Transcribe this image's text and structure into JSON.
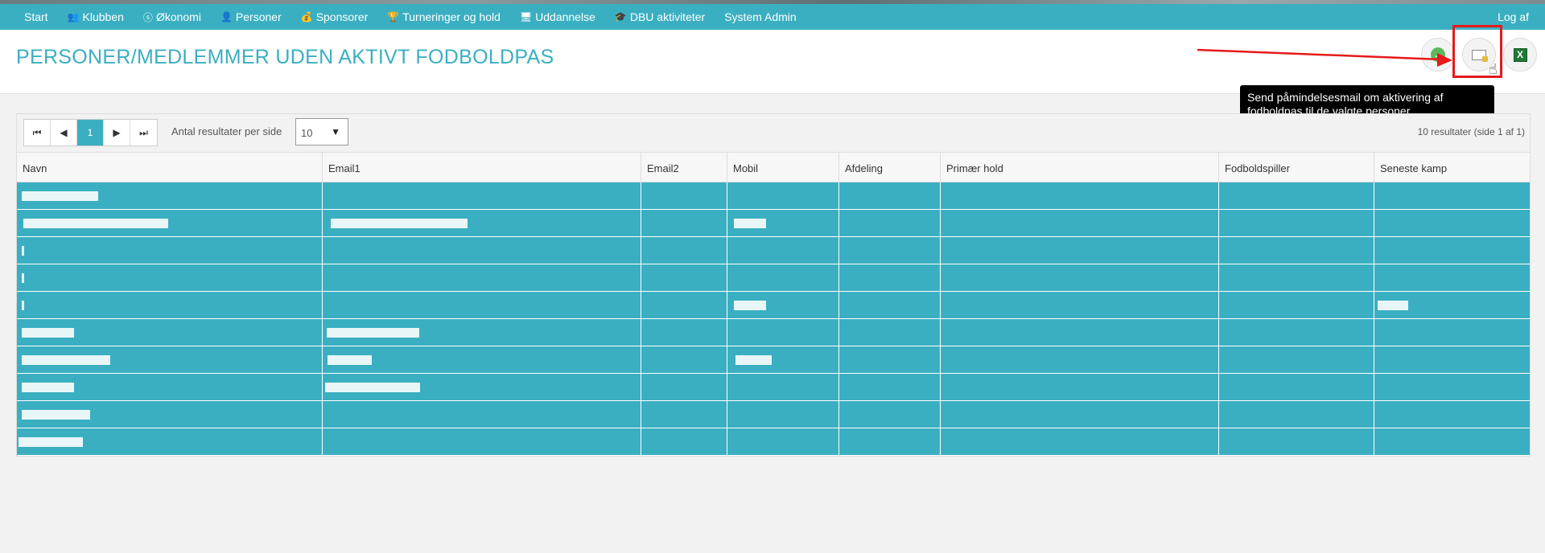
{
  "nav": {
    "items": [
      {
        "label": "Start",
        "icon": ""
      },
      {
        "label": "Klubben",
        "icon": "people-icon"
      },
      {
        "label": "Økonomi",
        "icon": "coin-icon"
      },
      {
        "label": "Personer",
        "icon": "person-icon"
      },
      {
        "label": "Sponsorer",
        "icon": "moneybag-icon"
      },
      {
        "label": "Turneringer og hold",
        "icon": "trophy-icon"
      },
      {
        "label": "Uddannelse",
        "icon": "monitor-icon"
      },
      {
        "label": "DBU aktiviteter",
        "icon": "graduation-cap-icon"
      },
      {
        "label": "System Admin",
        "icon": ""
      }
    ],
    "logout": "Log af"
  },
  "header": {
    "title": "PERSONER/MEDLEMMER UDEN AKTIVT FODBOLDPAS"
  },
  "tooltip": {
    "text": "Send påmindelsesmail om aktivering af fodboldpas til de valgte personer"
  },
  "pager": {
    "current_page": "1",
    "per_page_label": "Antal resultater per side",
    "per_page_value": "10",
    "result_count": "10 resultater (side 1 af 1)"
  },
  "table": {
    "columns": [
      "Navn",
      "Email1",
      "Email2",
      "Mobil",
      "Afdeling",
      "Primær hold",
      "Fodboldspiller",
      "Seneste kamp"
    ],
    "row_count": 10
  },
  "colors": {
    "accent": "#3aafc1",
    "highlight": "#e51a1a"
  }
}
